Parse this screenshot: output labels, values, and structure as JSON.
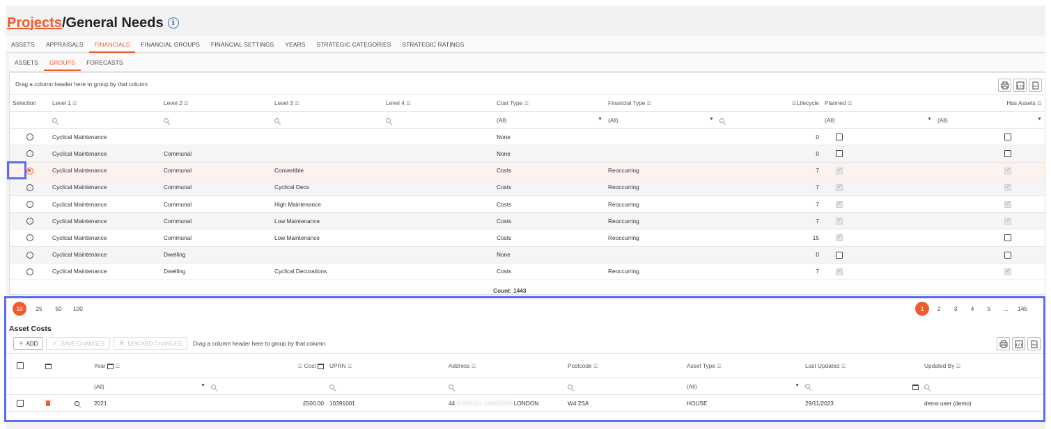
{
  "title": {
    "link": "Projects",
    "rest": "/General Needs"
  },
  "main_tabs": [
    "ASSETS",
    "APPRAISALS",
    "FINANCIALS",
    "FINANCIAL GROUPS",
    "FINANCIAL SETTINGS",
    "YEARS",
    "STRATEGIC CATEGORIES",
    "STRATEGIC RATINGS"
  ],
  "main_active": "FINANCIALS",
  "sub_tabs": [
    "ASSETS",
    "GROUPS",
    "FORECASTS"
  ],
  "sub_active": "GROUPS",
  "groups_grid": {
    "group_hint": "Drag a column header here to group by that column",
    "headers": [
      "Selection",
      "Level 1",
      "Level 2",
      "Level 3",
      "Level 4",
      "Cost Type",
      "Financial Type",
      "Lifecycle",
      "Planned",
      "Has Assets"
    ],
    "filter_all": "(All)",
    "rows": [
      {
        "selected": false,
        "level1": "Cyclical Maintenance",
        "level2": "",
        "level3": "",
        "level4": "",
        "cost_type": "None",
        "financial_type": "",
        "lifecycle": "0",
        "planned": false,
        "has_assets": false
      },
      {
        "selected": false,
        "level1": "Cyclical Maintenance",
        "level2": "Communal",
        "level3": "",
        "level4": "",
        "cost_type": "None",
        "financial_type": "",
        "lifecycle": "0",
        "planned": false,
        "has_assets": false
      },
      {
        "selected": true,
        "level1": "Cyclical Maintenance",
        "level2": "Communal",
        "level3": "Convertible",
        "level4": "",
        "cost_type": "Costs",
        "financial_type": "Reoccurring",
        "lifecycle": "7",
        "planned": true,
        "has_assets": true
      },
      {
        "selected": false,
        "level1": "Cyclical Maintenance",
        "level2": "Communal",
        "level3": "Cyclical Decs",
        "level4": "",
        "cost_type": "Costs",
        "financial_type": "Reoccurring",
        "lifecycle": "7",
        "planned": true,
        "has_assets": true
      },
      {
        "selected": false,
        "level1": "Cyclical Maintenance",
        "level2": "Communal",
        "level3": "High Maintenance",
        "level4": "",
        "cost_type": "Costs",
        "financial_type": "Reoccurring",
        "lifecycle": "7",
        "planned": true,
        "has_assets": true
      },
      {
        "selected": false,
        "level1": "Cyclical Maintenance",
        "level2": "Communal",
        "level3": "Low Maintenance",
        "level4": "",
        "cost_type": "Costs",
        "financial_type": "Reoccurring",
        "lifecycle": "7",
        "planned": true,
        "has_assets": true
      },
      {
        "selected": false,
        "level1": "Cyclical Maintenance",
        "level2": "Communal",
        "level3": "Low Maintenance",
        "level4": "",
        "cost_type": "Costs",
        "financial_type": "Reoccurring",
        "lifecycle": "15",
        "planned": true,
        "has_assets": false
      },
      {
        "selected": false,
        "level1": "Cyclical Maintenance",
        "level2": "Dwelling",
        "level3": "",
        "level4": "",
        "cost_type": "None",
        "financial_type": "",
        "lifecycle": "0",
        "planned": false,
        "has_assets": false
      },
      {
        "selected": false,
        "level1": "Cyclical Maintenance",
        "level2": "Dwelling",
        "level3": "Cyclical Decorations",
        "level4": "",
        "cost_type": "Costs",
        "financial_type": "Reoccurring",
        "lifecycle": "7",
        "planned": true,
        "has_assets": true
      }
    ],
    "count_label": "Count: 1443"
  },
  "pager": {
    "sizes": [
      "10",
      "25",
      "50",
      "100"
    ],
    "active_size": "10",
    "pages": [
      "1",
      "2",
      "3",
      "4",
      "5",
      "...",
      "145"
    ],
    "active_page": "1"
  },
  "asset_costs": {
    "title": "Asset Costs",
    "add_label": "ADD",
    "save_label": "SAVE CHANGES",
    "discard_label": "DISCARD CHANGES",
    "group_hint": "Drag a column header here to group by that column",
    "headers": {
      "year": "Year",
      "cost": "Cost",
      "uprn": "UPRN",
      "address": "Address",
      "postcode": "Postcode",
      "asset_type": "Asset Type",
      "last_updated": "Last Updated",
      "updated_by": "Updated By"
    },
    "filter_all": "(All)",
    "row": {
      "year": "2021",
      "cost": "£500.00",
      "uprn": "10391001",
      "address_prefix": "44",
      "address_blur": "STAPLEY GARDENS",
      "address_city": "LONDON",
      "postcode": "W4 2SA",
      "asset_type": "HOUSE",
      "last_updated": "29/11/2023",
      "updated_by": "demo user (demo)"
    }
  },
  "colors": {
    "accent": "#ef5b2f",
    "highlight": "#5b6cf0",
    "info": "#3e6fb6"
  }
}
